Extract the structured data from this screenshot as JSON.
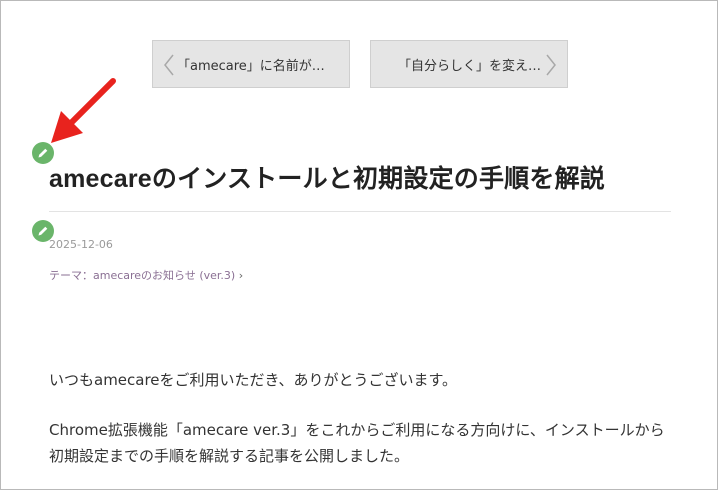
{
  "nav": {
    "prev_label": "「amecare」に名前が…",
    "next_label": "「自分らしく」を変え…"
  },
  "article": {
    "title": "amecareのインストールと初期設定の手順を解説",
    "date": "2025-12-06",
    "theme_label": "テーマ：amecareのお知らせ (ver.3)",
    "theme_chevron": "›",
    "paragraphs": [
      "いつもamecareをご利用いただき、ありがとうございます。",
      "Chrome拡張機能「amecare ver.3」をこれからご利用になる方向けに、インストールから初期設定までの手順を解説する記事を公開しました。"
    ]
  },
  "icons": {
    "edit": "pencil-icon",
    "annotation": "red-arrow-icon",
    "prev": "chevron-left-icon",
    "next": "chevron-right-icon"
  },
  "colors": {
    "edit_badge": "#6ab56a",
    "annotation_arrow": "#e8231e",
    "theme_link": "#8a6f93",
    "nav_bg": "#e5e5e5"
  }
}
